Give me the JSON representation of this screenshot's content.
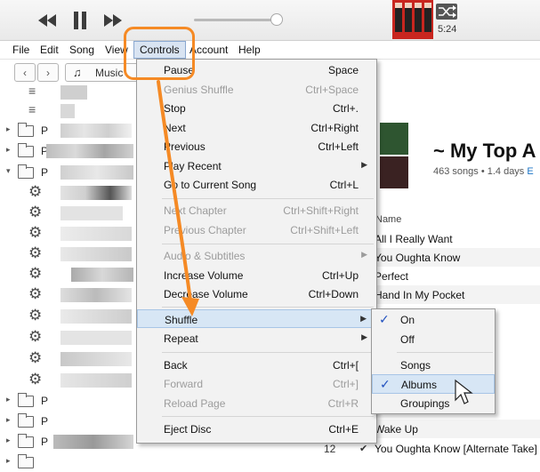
{
  "player": {
    "time": "5:24",
    "icons": [
      "rewind-icon",
      "pause-icon",
      "fast-forward-icon",
      "shuffle-icon"
    ]
  },
  "menubar": [
    "File",
    "Edit",
    "Song",
    "View",
    "Controls",
    "Account",
    "Help"
  ],
  "nav": {
    "source_label": "Music"
  },
  "sidebar": {
    "row_label": "P"
  },
  "playlist": {
    "title": "~ My Top A",
    "meta": "463 songs • 1.4 days",
    "meta_link": "E",
    "col_name": "Name",
    "songs": [
      {
        "name": "All I Really Want"
      },
      {
        "name": "You Oughta Know"
      },
      {
        "name": "Perfect"
      },
      {
        "name": "Hand In My Pocket"
      },
      {
        "name": "Wake Up"
      },
      {
        "num": "12",
        "check": "✔",
        "name": "You Oughta Know [Alternate Take]"
      }
    ]
  },
  "controls_menu": {
    "items": [
      {
        "label": "Pause",
        "shortcut": "Space"
      },
      {
        "label": "Genius Shuffle",
        "shortcut": "Ctrl+Space"
      },
      {
        "label": "Stop",
        "shortcut": "Ctrl+."
      },
      {
        "label": "Next",
        "shortcut": "Ctrl+Right"
      },
      {
        "label": "Previous",
        "shortcut": "Ctrl+Left"
      },
      {
        "label": "Play Recent",
        "shortcut": ""
      },
      {
        "label": "Go to Current Song",
        "shortcut": "Ctrl+L"
      },
      {
        "label": "Next Chapter",
        "shortcut": "Ctrl+Shift+Right"
      },
      {
        "label": "Previous Chapter",
        "shortcut": "Ctrl+Shift+Left"
      },
      {
        "label": "Audio & Subtitles",
        "shortcut": ""
      },
      {
        "label": "Increase Volume",
        "shortcut": "Ctrl+Up"
      },
      {
        "label": "Decrease Volume",
        "shortcut": "Ctrl+Down"
      },
      {
        "label": "Shuffle",
        "shortcut": ""
      },
      {
        "label": "Repeat",
        "shortcut": ""
      },
      {
        "label": "Back",
        "shortcut": "Ctrl+["
      },
      {
        "label": "Forward",
        "shortcut": "Ctrl+]"
      },
      {
        "label": "Reload Page",
        "shortcut": "Ctrl+R"
      },
      {
        "label": "Eject Disc",
        "shortcut": "Ctrl+E"
      }
    ]
  },
  "shuffle_submenu": {
    "items": [
      {
        "label": "On",
        "check": "✓"
      },
      {
        "label": "Off",
        "check": ""
      },
      {
        "label": "Songs",
        "check": ""
      },
      {
        "label": "Albums",
        "check": "✓"
      },
      {
        "label": "Groupings",
        "check": ""
      }
    ]
  },
  "colors": {
    "highlight": "#d7e6f5",
    "callout": "#f58a25",
    "check": "#1f4fbf"
  }
}
